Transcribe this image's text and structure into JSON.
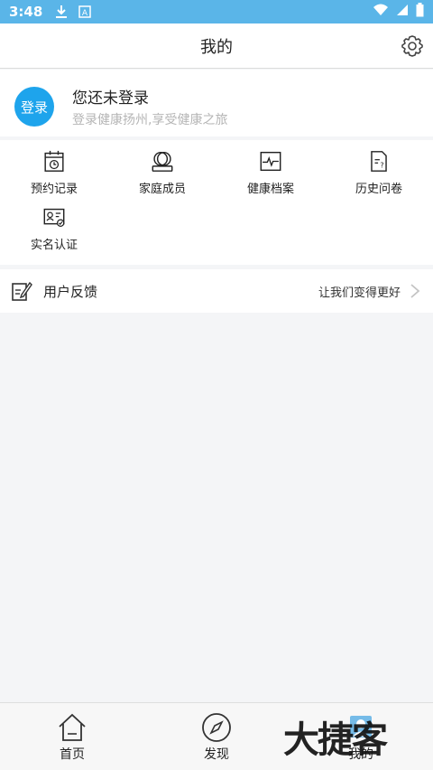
{
  "status_bar": {
    "time": "3:48",
    "icons": [
      "download-icon",
      "app-a-icon",
      "wifi-icon",
      "signal-icon",
      "battery-icon"
    ]
  },
  "header": {
    "title": "我的",
    "settings_icon": "gear-icon"
  },
  "profile": {
    "login_button": "登录",
    "name": "您还未登录",
    "subtitle": "登录健康扬州,享受健康之旅"
  },
  "grid": {
    "items": [
      {
        "label": "预约记录",
        "icon": "calendar-clock-icon"
      },
      {
        "label": "家庭成员",
        "icon": "family-members-icon"
      },
      {
        "label": "健康档案",
        "icon": "health-record-icon"
      },
      {
        "label": "历史问卷",
        "icon": "questionnaire-icon"
      },
      {
        "label": "实名认证",
        "icon": "id-card-icon"
      }
    ]
  },
  "feedback": {
    "label": "用户反馈",
    "hint": "让我们变得更好",
    "icon": "edit-note-icon"
  },
  "tabbar": {
    "tabs": [
      {
        "label": "首页",
        "icon": "home-icon"
      },
      {
        "label": "发现",
        "icon": "compass-icon"
      },
      {
        "label": "我的",
        "icon": "profile-icon"
      }
    ]
  },
  "watermark": "大捷客",
  "colors": {
    "status_bar": "#5ab5e8",
    "login_button": "#1ea4ec",
    "background": "#f4f5f7"
  }
}
